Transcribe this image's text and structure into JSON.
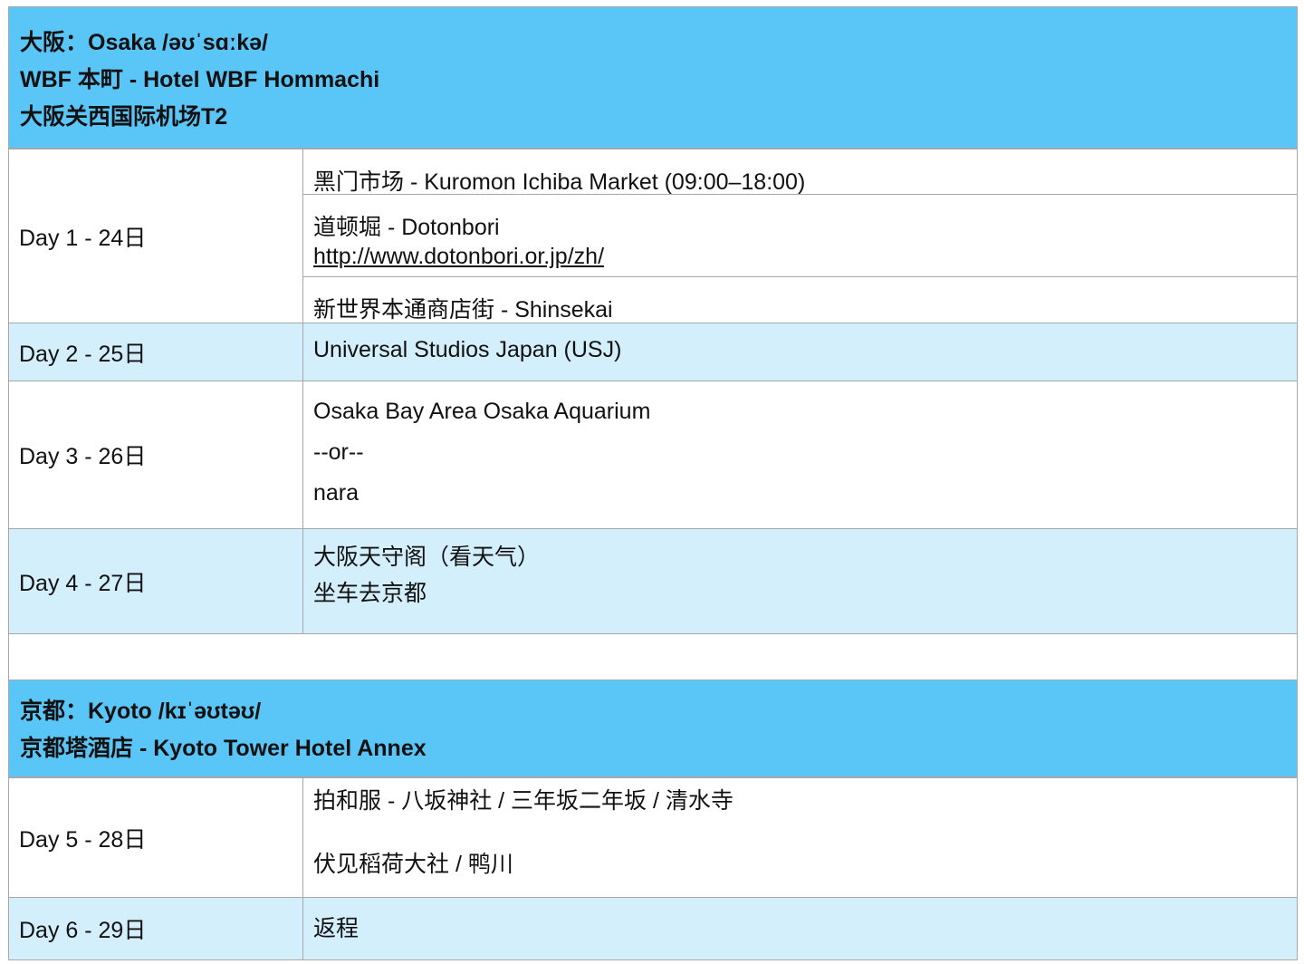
{
  "osaka": {
    "title": "大阪：Osaka /əʊˈsɑːkə/",
    "hotel": "WBF 本町 - Hotel WBF Hommachi",
    "airport": "大阪关西国际机场T2"
  },
  "days": {
    "d1": {
      "label": "Day 1 - 24日",
      "item1": "黑门市场 - Kuromon Ichiba Market (09:00–18:00)",
      "item2": "道顿堀 - Dotonbori",
      "item2_link": "http://www.dotonbori.or.jp/zh/",
      "item3": "新世界本通商店街 - Shinsekai"
    },
    "d2": {
      "label": "Day 2 - 25日",
      "item1": "Universal Studios Japan (USJ)"
    },
    "d3": {
      "label": "Day 3 - 26日",
      "item1": "Osaka Bay Area Osaka Aquarium",
      "item2": "--or--",
      "item3": "nara"
    },
    "d4": {
      "label": "Day 4 - 27日",
      "item1": "大阪天守阁（看天气）",
      "item2": "坐车去京都"
    },
    "d5": {
      "label": "Day 5 - 28日",
      "item1": "拍和服 - 八坂神社 / 三年坂二年坂 / 清水寺",
      "item2": "伏见稻荷大社 /  鸭川"
    },
    "d6": {
      "label": "Day 6 - 29日",
      "item1": "返程"
    }
  },
  "kyoto": {
    "title": "京都：Kyoto /kɪˈəʊtəʊ/",
    "hotel": "京都塔酒店 - Kyoto Tower Hotel Annex"
  }
}
